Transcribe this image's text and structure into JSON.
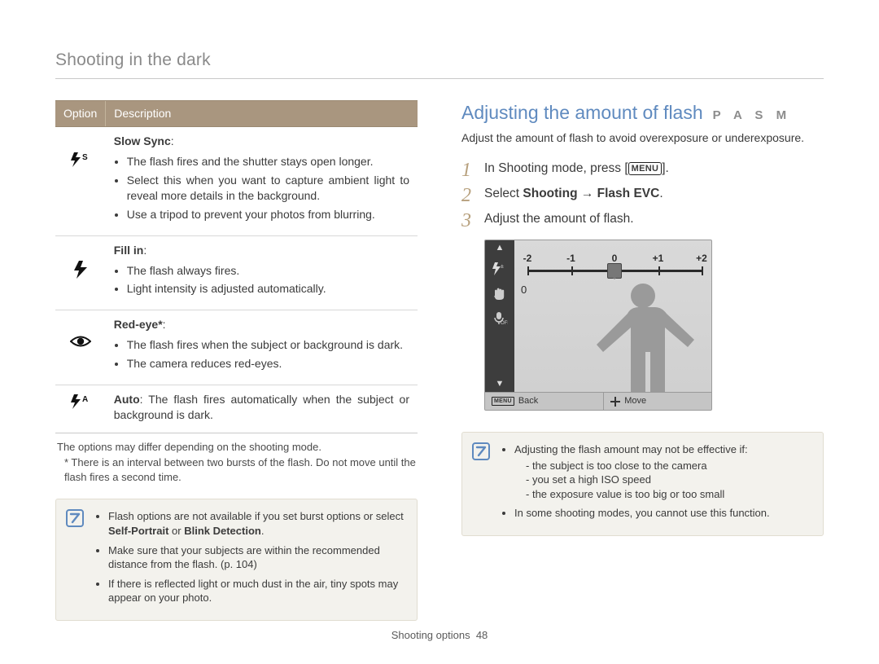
{
  "section_title": "Shooting in the dark",
  "table": {
    "headers": [
      "Option",
      "Description"
    ],
    "rows": [
      {
        "icon": "flash-slow-sync",
        "name": "Slow Sync",
        "name_suffix": ":",
        "bullets": [
          "The flash fires and the shutter stays open longer.",
          "Select this when you want to capture ambient light to reveal more details in the background.",
          "Use a tripod to prevent your photos from blurring."
        ]
      },
      {
        "icon": "flash-fill-in",
        "name": "Fill in",
        "name_suffix": ":",
        "bullets": [
          "The flash always fires.",
          "Light intensity is adjusted automatically."
        ]
      },
      {
        "icon": "red-eye",
        "name": "Red-eye*",
        "name_suffix": ":",
        "bullets": [
          "The flash fires when the subject or background is dark.",
          "The camera reduces red-eyes."
        ]
      },
      {
        "icon": "flash-auto",
        "inline_name": "Auto",
        "inline_text": ": The flash fires automatically when the subject or background is dark."
      }
    ]
  },
  "footnotes": [
    "The options may differ depending on the shooting mode.",
    "* There is an interval between two bursts of the flash. Do not move until the flash fires a second time."
  ],
  "infobox_left": {
    "items": [
      {
        "pre": "Flash options are not available if you set burst options or select ",
        "bold": "Self-Portrait",
        "mid": " or ",
        "bold2": "Blink Detection",
        "post": "."
      },
      {
        "text": "Make sure that your subjects are within the recommended distance from the flash. (p. 104)"
      },
      {
        "text": "If there is reflected light or much dust in the air, tiny spots may appear on your photo."
      }
    ]
  },
  "right": {
    "heading": "Adjusting the amount of flash",
    "modes": "P A S M",
    "lead": "Adjust the amount of flash to avoid overexposure or underexposure.",
    "steps": {
      "s1_pre": "In Shooting mode, press [",
      "s1_chip": "MENU",
      "s1_post": "].",
      "s2_pre": "Select ",
      "s2_bold": "Shooting → Flash EVC",
      "s2_post": ".",
      "s3": "Adjust the amount of flash."
    },
    "lcd": {
      "scale": [
        "-2",
        "-1",
        "0",
        "+1",
        "+2"
      ],
      "value": "0",
      "footer_back": "Back",
      "footer_move": "Move",
      "footer_menu_chip": "MENU"
    },
    "infobox": {
      "line1": "Adjusting the flash amount may not be effective if:",
      "subs": [
        "the subject is too close to the camera",
        "you set a high ISO speed",
        "the exposure value is too big or too small"
      ],
      "line2": "In some shooting modes, you cannot use this function."
    }
  },
  "page_footer": {
    "label": "Shooting options",
    "num": "48"
  }
}
